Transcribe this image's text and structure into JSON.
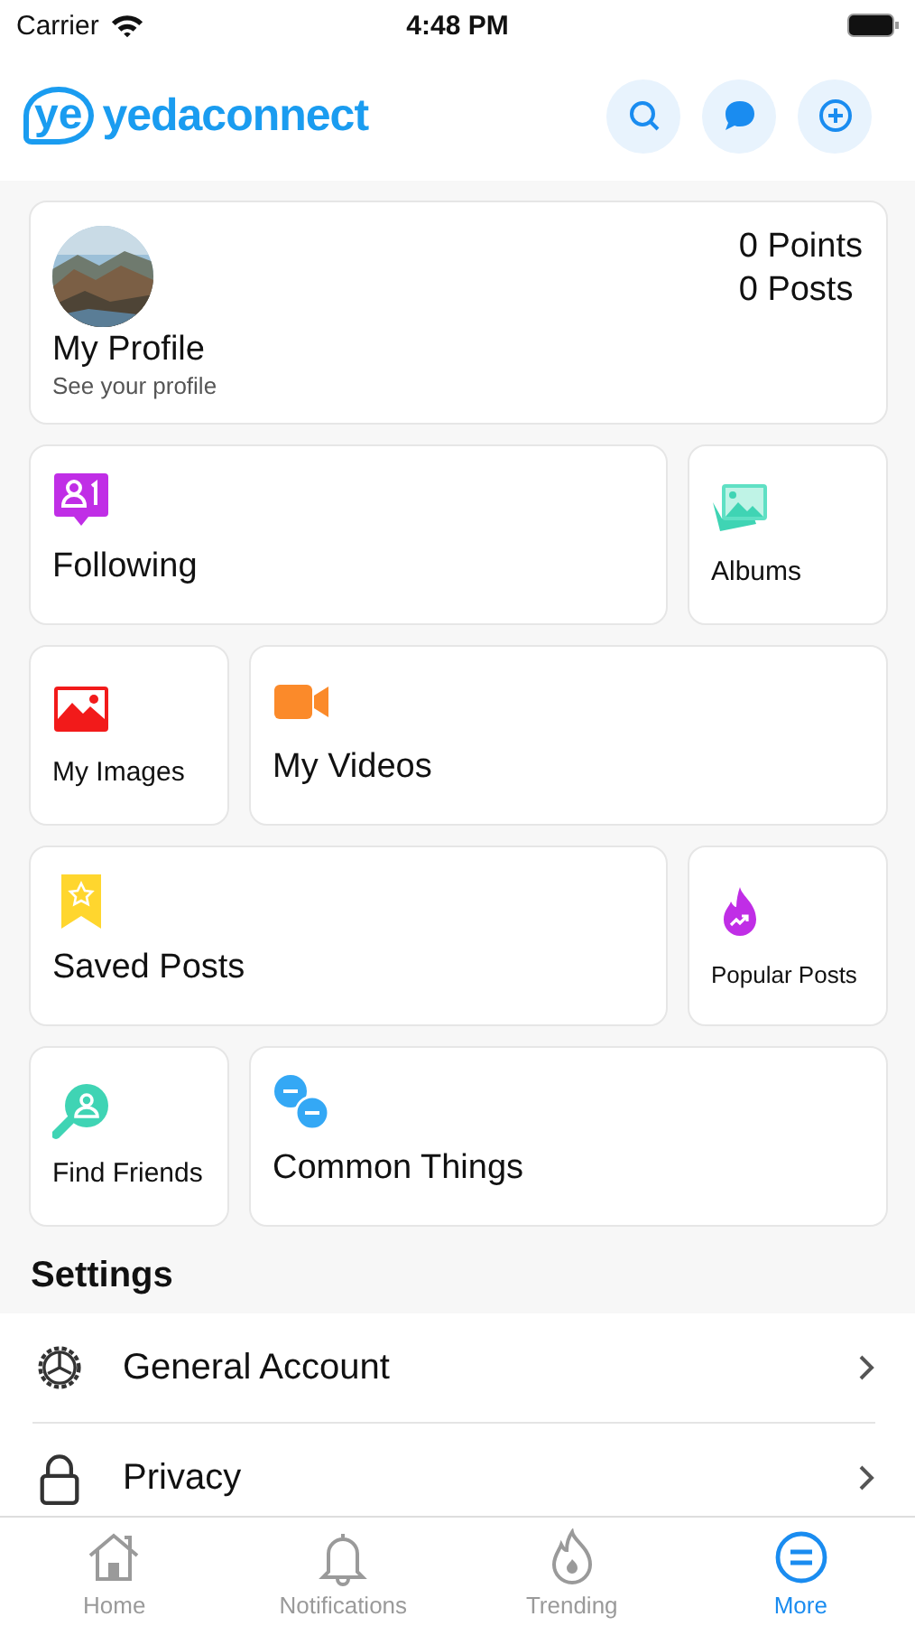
{
  "status_bar": {
    "carrier": "Carrier",
    "time": "4:48 PM"
  },
  "header": {
    "logo_mark": "ye",
    "logo_text": "yedaconnect",
    "actions": [
      {
        "kind": "search"
      },
      {
        "kind": "chat"
      },
      {
        "kind": "add"
      }
    ]
  },
  "profile": {
    "name": "My Profile",
    "subtitle": "See your profile",
    "points": "0 Points",
    "posts": "0 Posts"
  },
  "tile_rows": [
    [
      {
        "label": "Following",
        "kind": "following",
        "wide": true
      },
      {
        "label": "Albums",
        "kind": "albums",
        "wide": false
      }
    ],
    [
      {
        "label": "My Images",
        "kind": "images",
        "wide": false
      },
      {
        "label": "My Videos",
        "kind": "videos",
        "wide": true
      }
    ],
    [
      {
        "label": "Saved Posts",
        "kind": "saved",
        "wide": true
      },
      {
        "label": "Popular Posts",
        "kind": "popular",
        "wide": false
      }
    ],
    [
      {
        "label": "Find Friends",
        "kind": "find",
        "wide": false
      },
      {
        "label": "Common Things",
        "kind": "common",
        "wide": true
      }
    ]
  ],
  "settings": {
    "title": "Settings",
    "items": [
      {
        "label": "General Account",
        "kind": "gear"
      },
      {
        "label": "Privacy",
        "kind": "lock"
      }
    ]
  },
  "tabs": [
    {
      "label": "Home",
      "kind": "home",
      "selected": false
    },
    {
      "label": "Notifications",
      "kind": "bell",
      "selected": false
    },
    {
      "label": "Trending",
      "kind": "fire",
      "selected": false
    },
    {
      "label": "More",
      "kind": "more",
      "selected": true
    }
  ]
}
